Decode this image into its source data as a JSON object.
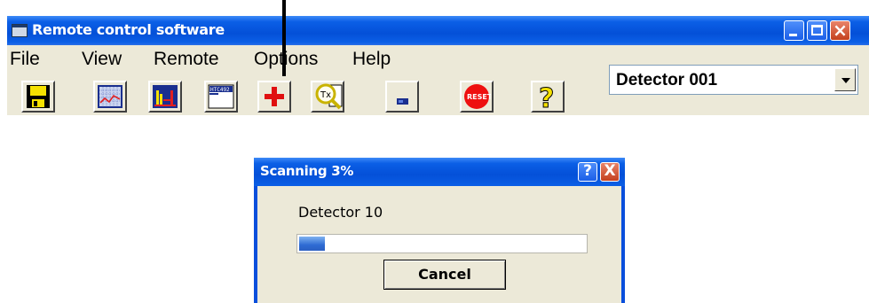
{
  "window": {
    "title": "Remote control software",
    "buttons": [
      "minimize",
      "maximize",
      "close"
    ]
  },
  "menu": [
    "File",
    "View",
    "Remote",
    "Options",
    "Help"
  ],
  "toolbar": {
    "buttons": [
      {
        "name": "save",
        "icon": "floppy-disk-icon"
      },
      {
        "name": "graph",
        "icon": "line-graph-icon"
      },
      {
        "name": "spectrum",
        "icon": "bar-spectrum-icon"
      },
      {
        "name": "display",
        "icon": "text-display-icon",
        "icon_text": "HTC492"
      },
      {
        "name": "add",
        "icon": "red-cross-icon"
      },
      {
        "name": "tx-search",
        "icon": "magnifier-tx-icon",
        "icon_text": "Tx"
      },
      {
        "name": "panel",
        "icon": "panel-icon"
      },
      {
        "name": "reset",
        "icon": "reset-icon",
        "icon_text": "RESET"
      },
      {
        "name": "help",
        "icon": "question-mark-icon",
        "icon_text": "?"
      }
    ],
    "detector_select": {
      "value": "Detector 001"
    }
  },
  "dialog": {
    "title": "Scanning 3%",
    "label": "Detector 10",
    "progress": 0.03,
    "cancel_label": "Cancel",
    "help_glyph": "?",
    "close_glyph": "X"
  }
}
